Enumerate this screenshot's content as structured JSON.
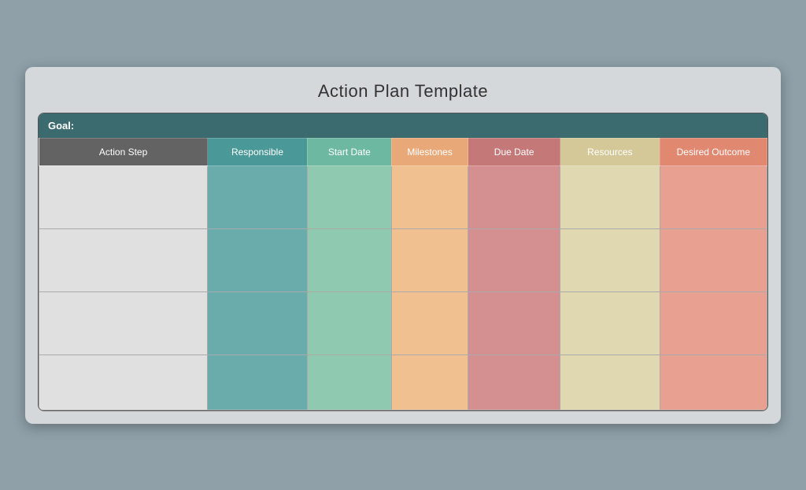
{
  "page": {
    "title": "Action Plan Template",
    "goal_label": "Goal:"
  },
  "columns": [
    {
      "id": "action-step",
      "label": "Action Step",
      "class": "col-action"
    },
    {
      "id": "responsible",
      "label": "Responsible",
      "class": "col-responsible"
    },
    {
      "id": "start-date",
      "label": "Start Date",
      "class": "col-startdate"
    },
    {
      "id": "milestones",
      "label": "Milestones",
      "class": "col-milestones"
    },
    {
      "id": "due-date",
      "label": "Due Date",
      "class": "col-duedate"
    },
    {
      "id": "resources",
      "label": "Resources",
      "class": "col-resources"
    },
    {
      "id": "desired-outcome",
      "label": "Desired Outcome",
      "class": "col-desired"
    }
  ],
  "rows": [
    {
      "cells": [
        "cell-action",
        "cell-responsible",
        "cell-startdate",
        "cell-milestones",
        "cell-duedate",
        "cell-resources",
        "cell-desired"
      ]
    },
    {
      "cells": [
        "cell-action",
        "cell-responsible",
        "cell-startdate",
        "cell-milestones",
        "cell-duedate",
        "cell-resources",
        "cell-desired"
      ]
    },
    {
      "cells": [
        "cell-action",
        "cell-responsible",
        "cell-startdate",
        "cell-milestones",
        "cell-duedate",
        "cell-resources",
        "cell-desired"
      ]
    },
    {
      "cells": [
        "cell-action",
        "cell-responsible",
        "cell-startdate",
        "cell-milestones",
        "cell-duedate",
        "cell-resources",
        "cell-desired"
      ]
    }
  ]
}
